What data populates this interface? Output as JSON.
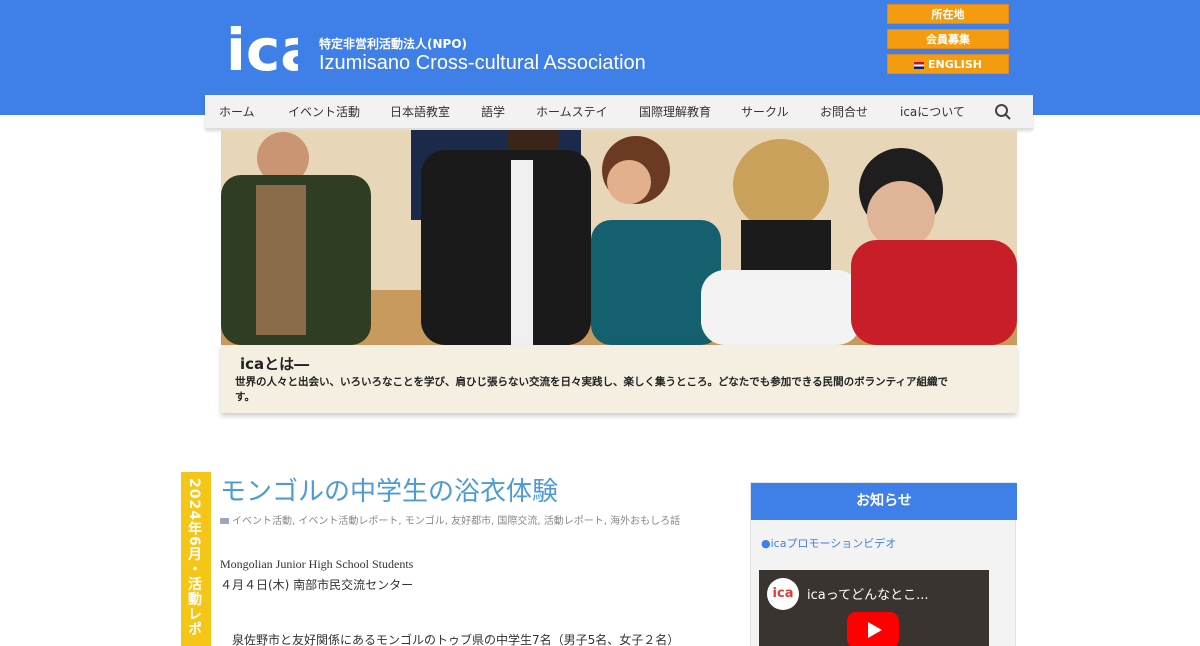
{
  "header": {
    "logo_text": "ica",
    "org_subtitle": "特定非営利活動法人(NPO)",
    "org_name": "Izumisano Cross-cultural Association",
    "buttons": {
      "location": "所在地",
      "members": "会員募集",
      "english": "ENGLISH"
    }
  },
  "nav": {
    "items": [
      {
        "label": "ホーム"
      },
      {
        "label": "イベント活動"
      },
      {
        "label": "日本語教室"
      },
      {
        "label": "語学"
      },
      {
        "label": "ホームステイ"
      },
      {
        "label": "国際理解教育"
      },
      {
        "label": "サークル"
      },
      {
        "label": "お問合せ"
      },
      {
        "label": "icaについて"
      }
    ],
    "search_icon": "search-icon"
  },
  "hero": {
    "intro_title": "icaとは―",
    "intro_text": "世界の人々と出会い、いろいろなことを学び、肩ひじ張らない交流を日々実践し、楽しく集うところ。どなたでも参加できる民間のボランティア組織です。"
  },
  "post": {
    "date_tag": "2024年6月・活動レポ",
    "title": "モンゴルの中学生の浴衣体験",
    "categories": "イベント活動, イベント活動レポート, モンゴル, 友好都市, 国際交流, 活動レポート, 海外おもしろ話",
    "subtitle_en": "Mongolian Junior High School Students",
    "date_line": "４月４日(木) 南部市民交流センター",
    "body_start": "泉佐野市と友好関係にあるモンゴルのトゥブ県の中学生7名（男子5名、女子２名）"
  },
  "sidebar": {
    "heading": "お知らせ",
    "link": "●icaプロモーションビデオ",
    "video_logo": "ica",
    "video_title": "icaってどんなとこ..."
  },
  "colors": {
    "brand_blue": "#3f7fe8",
    "button_orange": "#f59b0f",
    "title_blue": "#4d9bd6",
    "date_yellow": "#f5c518"
  }
}
